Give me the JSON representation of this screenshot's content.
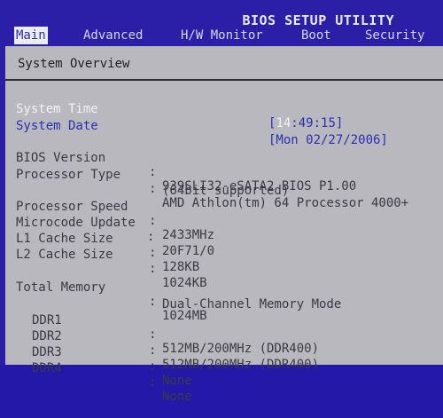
{
  "header": {
    "title": "BIOS SETUP UTILITY"
  },
  "menu": {
    "items": [
      {
        "label": "Main"
      },
      {
        "label": "Advanced"
      },
      {
        "label": "H/W Monitor"
      },
      {
        "label": "Boot"
      },
      {
        "label": "Security"
      }
    ]
  },
  "overview": {
    "title": "System Overview",
    "system_time_label": "System Time",
    "system_time_open": "[",
    "system_time_hours": "14",
    "system_time_rest": ":49:15]",
    "system_date_label": "System Date",
    "system_date_value": "[Mon 02/27/2006]",
    "rows": [
      {
        "label": "BIOS Version",
        "value": "939SLI32-eSATA2 BIOS P1.00"
      },
      {
        "label": "Processor Type",
        "value": "AMD Athlon(tm) 64 Processor 4000+"
      },
      {
        "label": "",
        "value": "(64bit supported)"
      },
      {
        "label": "Processor Speed",
        "value": "2433MHz"
      },
      {
        "label": "Microcode Update",
        "value": "20F71/0"
      },
      {
        "label": "L1 Cache Size",
        "value": "128KB"
      },
      {
        "label": "L2 Cache Size",
        "value": "1024KB"
      }
    ],
    "memory": {
      "total_label": "Total Memory",
      "total_value": "1024MB",
      "mode": "Dual-Channel Memory Mode",
      "slots": [
        {
          "label": "DDR1",
          "value": "512MB/200MHz (DDR400)"
        },
        {
          "label": "DDR2",
          "value": "512MB/200MHz (DDR400)"
        },
        {
          "label": "DDR3",
          "value": "None"
        },
        {
          "label": "DDR4",
          "value": "None"
        }
      ]
    },
    "colon": ":"
  }
}
